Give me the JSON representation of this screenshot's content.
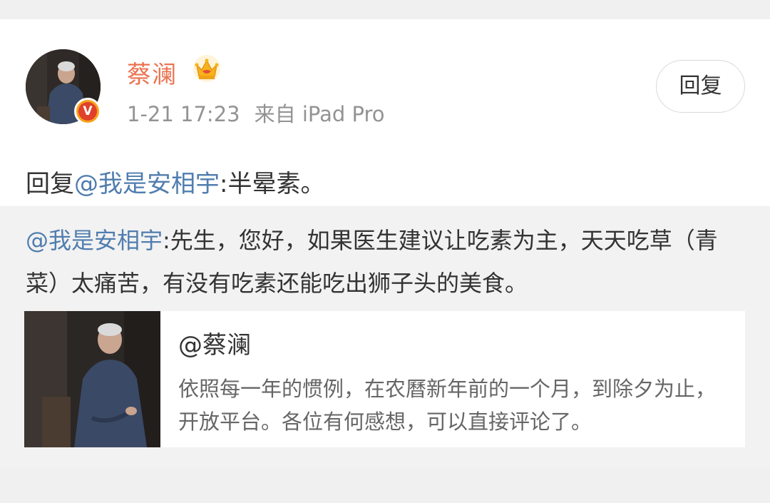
{
  "post": {
    "username": "蔡澜",
    "timestamp": "1-21 17:23",
    "source": "来自 iPad Pro",
    "reply_button": "回复",
    "verified_badge": "V",
    "reply_prefix": "回复",
    "reply_mention": "@我是安相宇",
    "reply_body": ":半晕素。"
  },
  "quote": {
    "mention": "@我是安相宇",
    "text": ":先生，您好，如果医生建议让吃素为主，天天吃草（青菜）太痛苦，有没有吃素还能吃出狮子头的美食。"
  },
  "embed": {
    "title": "@蔡澜",
    "description": "依照每一年的惯例，在农曆新年前的一个月，到除夕为止，开放平台。各位有何感想，可以直接评论了。"
  },
  "colors": {
    "username": "#eb7350",
    "mention": "#507daf",
    "badge_outer": "#f8a31c",
    "badge_inner": "#e0412a"
  },
  "icons": [
    "crown-icon",
    "verified-badge-icon"
  ]
}
